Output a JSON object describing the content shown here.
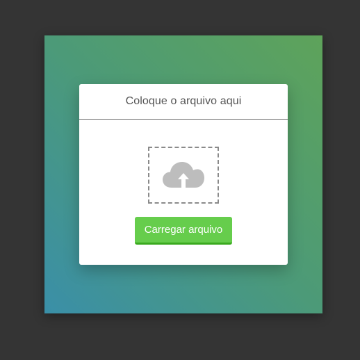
{
  "card": {
    "title": "Coloque o arquivo aqui"
  },
  "dropzone": {
    "icon": "cloud-upload-icon"
  },
  "upload_button": {
    "label": "Carregar arquivo"
  },
  "colors": {
    "page_background": "#343434",
    "gradient_top_right": "#5ea35a",
    "gradient_bottom_left": "#3a8fa8",
    "card_background": "#ffffff",
    "button_green": "#66cd4c",
    "button_green_dark": "#3aa91f",
    "icon_gray": "#bdbdbd"
  }
}
